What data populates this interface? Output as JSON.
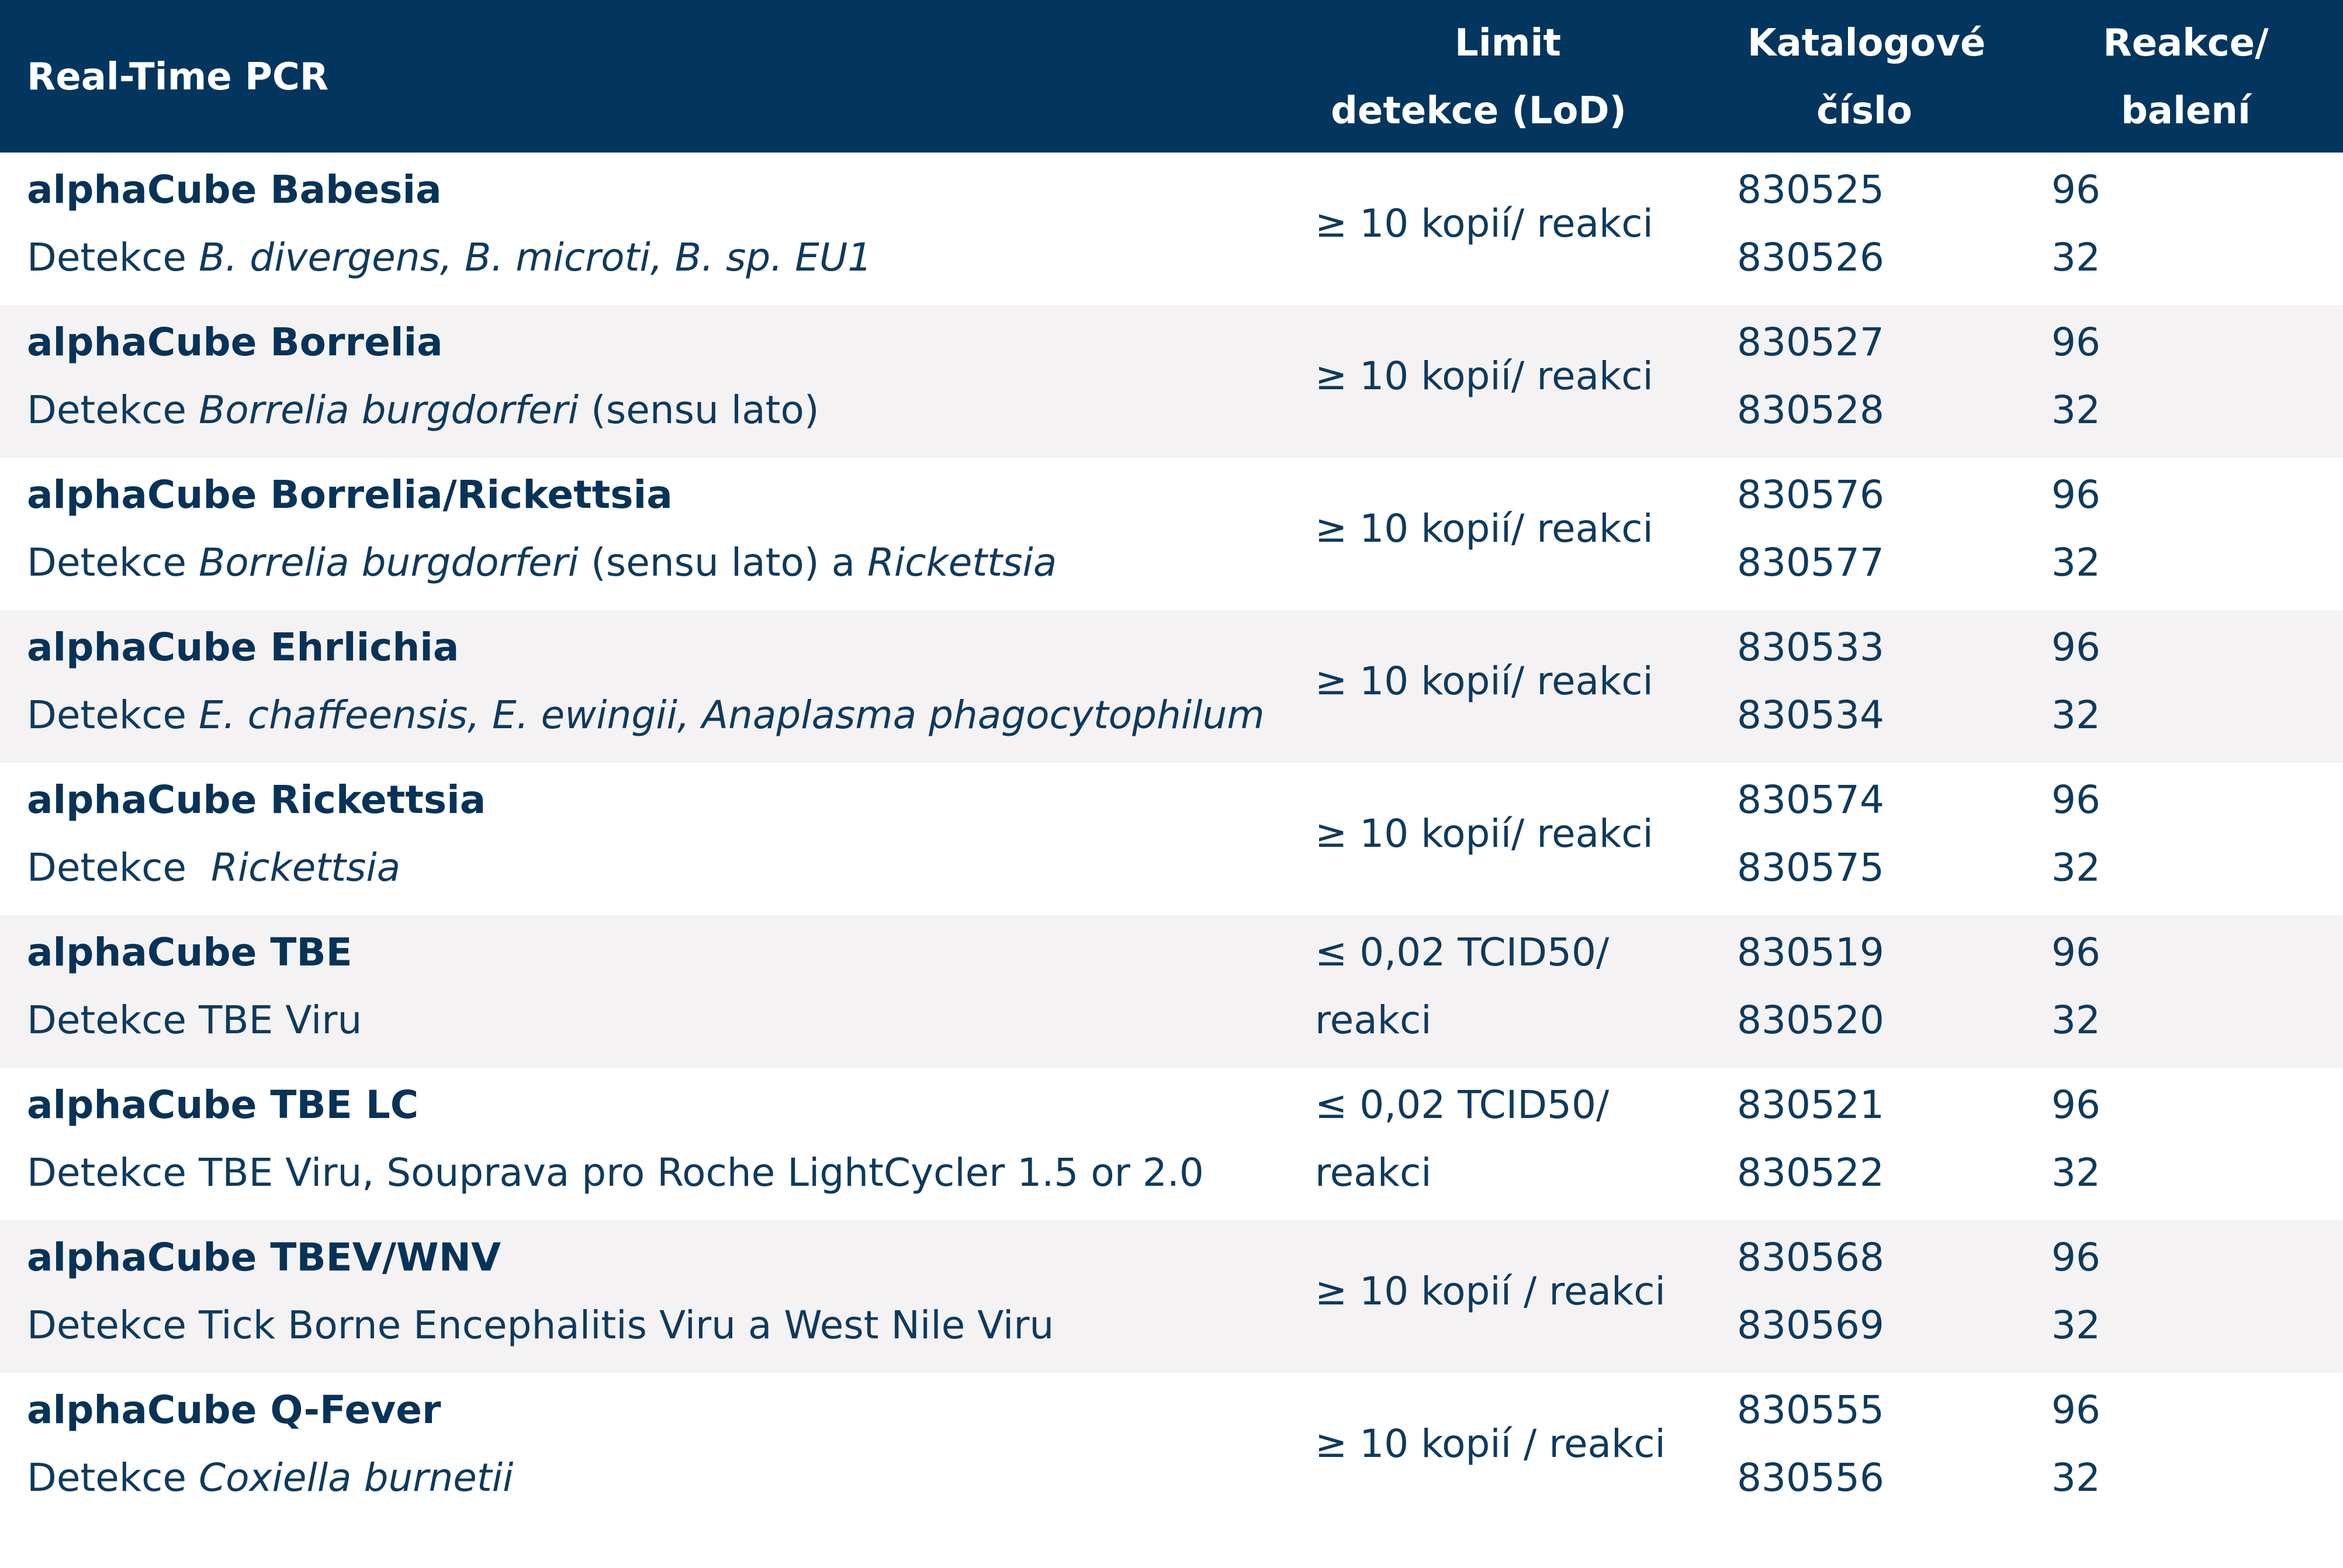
{
  "header": {
    "col_product": "Real-Time PCR",
    "col_lod_line1": "Limit",
    "col_lod_line2": "detekce (LoD)",
    "col_catalog_line1": "Katalogové",
    "col_catalog_line2": "číslo",
    "col_pack_line1": "Reakce/",
    "col_pack_line2": "balení"
  },
  "rows": [
    {
      "name": "alphaCube Babesia",
      "desc_prefix": "Detekce ",
      "desc_italic": "B. divergens, B. microti, B. sp. EU1",
      "desc_suffix": "",
      "lod": "≥ 10 kopií/ reakci",
      "cat1": "830525",
      "cat2": "830526",
      "pack1": "96",
      "pack2": "32"
    },
    {
      "name": "alphaCube Borrelia",
      "desc_prefix": "Detekce ",
      "desc_italic": "Borrelia burgdorferi",
      "desc_suffix": " (sensu lato)",
      "lod": "≥ 10 kopií/ reakci",
      "cat1": "830527",
      "cat2": "830528",
      "pack1": "96",
      "pack2": "32"
    },
    {
      "name": "alphaCube Borrelia/Rickettsia",
      "desc_prefix": "Detekce ",
      "desc_italic": "Borrelia burgdorferi",
      "desc_suffix": " (sensu lato) a ",
      "desc_italic2": "Rickettsia",
      "lod": "≥ 10 kopií/ reakci",
      "cat1": "830576",
      "cat2": "830577",
      "pack1": "96",
      "pack2": "32"
    },
    {
      "name": "alphaCube Ehrlichia",
      "desc_prefix": "Detekce ",
      "desc_italic": "E. chaffeensis, E. ewingii, Anaplasma phagocytophilum",
      "desc_suffix": "",
      "lod": "≥ 10 kopií/ reakci",
      "cat1": "830533",
      "cat2": "830534",
      "pack1": "96",
      "pack2": "32"
    },
    {
      "name": "alphaCube Rickettsia",
      "desc_prefix": "Detekce  ",
      "desc_italic": "Rickettsia",
      "desc_suffix": "",
      "lod": "≥ 10 kopií/ reakci",
      "cat1": "830574",
      "cat2": "830575",
      "pack1": "96",
      "pack2": "32"
    },
    {
      "name": "alphaCube TBE",
      "desc_prefix": "Detekce TBE Viru",
      "desc_italic": "",
      "desc_suffix": "",
      "lod_line1": "≤ 0,02 TCID50/",
      "lod_line2": "reakci",
      "cat1": "830519",
      "cat2": "830520",
      "pack1": "96",
      "pack2": "32"
    },
    {
      "name": "alphaCube TBE LC",
      "desc_prefix": "Detekce TBE Viru, Souprava pro Roche LightCycler 1.5 or 2.0",
      "desc_italic": "",
      "desc_suffix": "",
      "lod_line1": "≤ 0,02 TCID50/",
      "lod_line2": "reakci",
      "cat1": "830521",
      "cat2": "830522",
      "pack1": "96",
      "pack2": "32"
    },
    {
      "name": "alphaCube TBEV/WNV",
      "desc_prefix": "Detekce Tick Borne Encephalitis Viru a West Nile Viru",
      "desc_italic": "",
      "desc_suffix": "",
      "lod": "≥ 10 kopií / reakci",
      "cat1": "830568",
      "cat2": "830569",
      "pack1": "96",
      "pack2": "32"
    },
    {
      "name": "alphaCube Q-Fever",
      "desc_prefix": "Detekce ",
      "desc_italic": "Coxiella burnetii",
      "desc_suffix": "",
      "lod": "≥ 10 kopií / reakci",
      "cat1": "830555",
      "cat2": "830556",
      "pack1": "96",
      "pack2": "32"
    }
  ],
  "colors": {
    "header_bg": "#03365f",
    "header_text": "#ffffff",
    "body_text": "#0b3358",
    "alt_row_bg": "#f4f2f3"
  }
}
